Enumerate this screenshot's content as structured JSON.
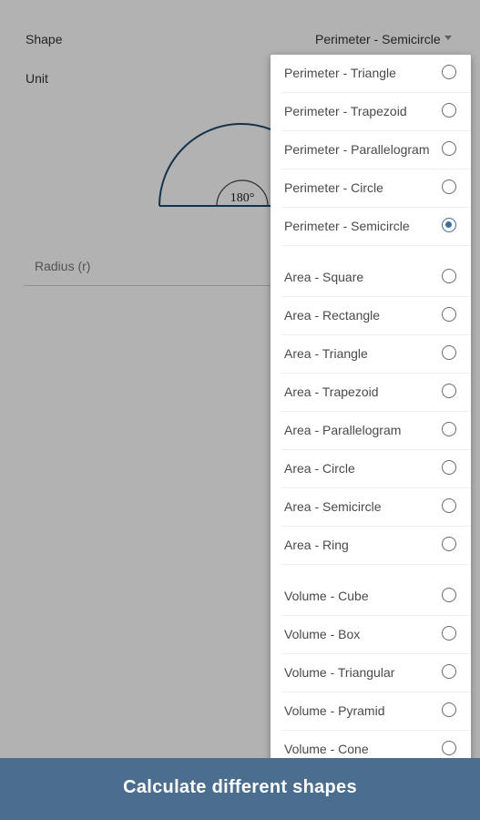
{
  "form": {
    "shape_label": "Shape",
    "unit_label": "Unit",
    "shape_value": "Perimeter - Semicircle",
    "radius_placeholder": "Radius (r)",
    "diagram_angle": "180°"
  },
  "menu": {
    "selected_index": 4,
    "items": [
      {
        "label": "Perimeter - Triangle"
      },
      {
        "label": "Perimeter - Trapezoid"
      },
      {
        "label": "Perimeter - Parallelogram"
      },
      {
        "label": "Perimeter - Circle"
      },
      {
        "label": "Perimeter - Semicircle"
      },
      {
        "label": "Area - Square"
      },
      {
        "label": "Area - Rectangle"
      },
      {
        "label": "Area - Triangle"
      },
      {
        "label": "Area - Trapezoid"
      },
      {
        "label": "Area - Parallelogram"
      },
      {
        "label": "Area - Circle"
      },
      {
        "label": "Area - Semicircle"
      },
      {
        "label": "Area - Ring"
      },
      {
        "label": "Volume - Cube"
      },
      {
        "label": "Volume - Box"
      },
      {
        "label": "Volume - Triangular"
      },
      {
        "label": "Volume - Pyramid"
      },
      {
        "label": "Volume - Cone"
      }
    ]
  },
  "banner": {
    "text": "Calculate different shapes"
  },
  "colors": {
    "accent": "#3b6e9c",
    "banner": "#4c6e8e",
    "diagram_stroke": "#1f4a6b"
  }
}
